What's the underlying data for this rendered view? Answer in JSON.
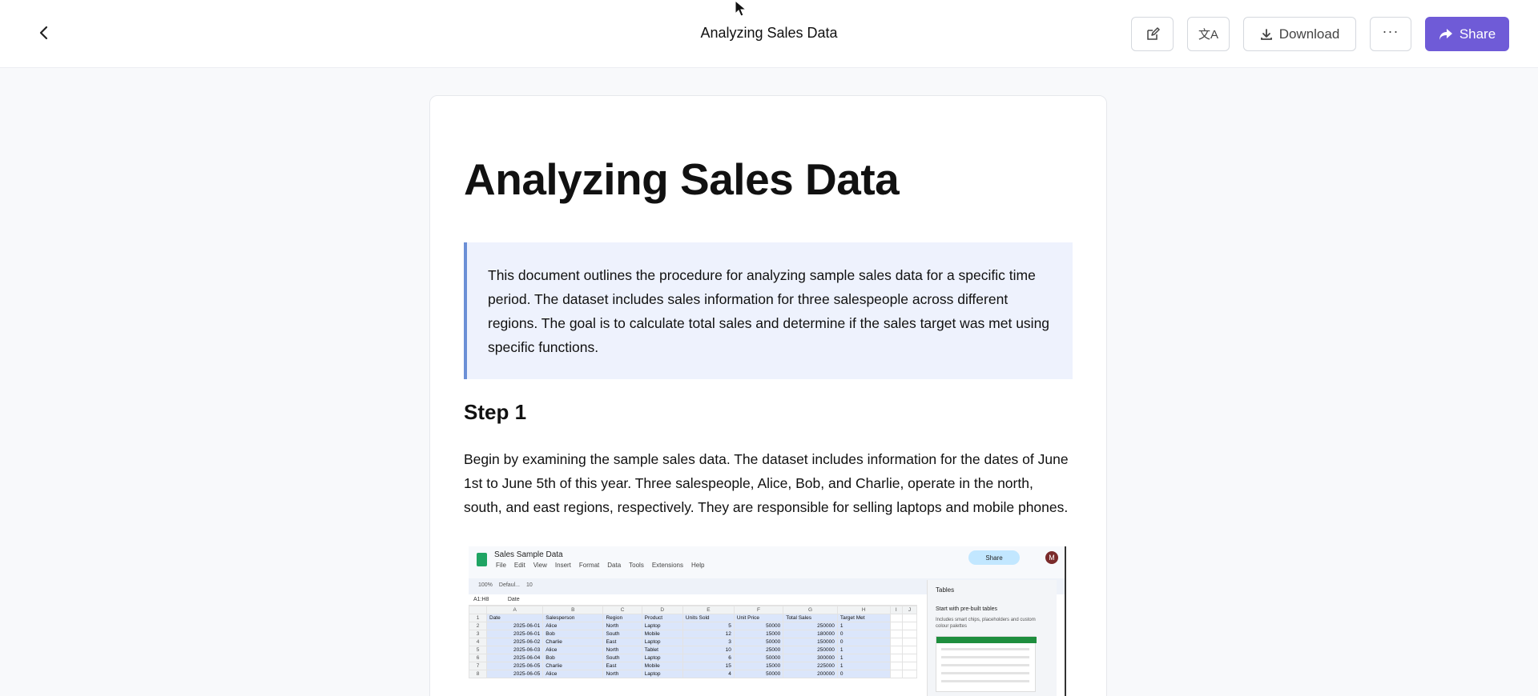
{
  "header": {
    "title": "Analyzing Sales Data",
    "download_label": "Download",
    "share_label": "Share"
  },
  "document": {
    "title": "Analyzing Sales Data",
    "intro": "This document outlines the procedure for analyzing sample sales data for a specific time period. The dataset includes sales information for three salespeople across different regions. The goal is to calculate total sales and determine if the sales target was met using specific functions.",
    "steps": [
      {
        "heading": "Step 1",
        "text": "Begin by examining the sample sales data. The dataset includes information for the dates of June 1st to June 5th of this year. Three salespeople, Alice, Bob, and Charlie, operate in the north, south, and east regions, respectively. They are responsible for selling laptops and mobile phones."
      }
    ]
  },
  "screenshot": {
    "file_name": "Sales Sample Data",
    "menu": [
      "File",
      "Edit",
      "View",
      "Insert",
      "Format",
      "Data",
      "Tools",
      "Extensions",
      "Help"
    ],
    "share_label": "Share",
    "avatar_letter": "M",
    "toolbar_zoom": "100%",
    "toolbar_font": "Defaul...",
    "toolbar_size": "10",
    "cell_ref": "A1:H8",
    "formula_value": "Date",
    "col_letters": [
      "A",
      "B",
      "C",
      "D",
      "E",
      "F",
      "G",
      "H",
      "I",
      "J"
    ],
    "headers": [
      "Date",
      "Salesperson",
      "Region",
      "Product",
      "Units Sold",
      "Unit Price",
      "Total Sales",
      "Target Met"
    ],
    "rows": [
      [
        "2025-06-01",
        "Alice",
        "North",
        "Laptop",
        "5",
        "50000",
        "250000",
        "1"
      ],
      [
        "2025-06-01",
        "Bob",
        "South",
        "Mobile",
        "12",
        "15000",
        "180000",
        "0"
      ],
      [
        "2025-06-02",
        "Charlie",
        "East",
        "Laptop",
        "3",
        "50000",
        "150000",
        "0"
      ],
      [
        "2025-06-03",
        "Alice",
        "North",
        "Tablet",
        "10",
        "25000",
        "250000",
        "1"
      ],
      [
        "2025-06-04",
        "Bob",
        "South",
        "Laptop",
        "6",
        "50000",
        "300000",
        "1"
      ],
      [
        "2025-06-05",
        "Charlie",
        "East",
        "Mobile",
        "15",
        "15000",
        "225000",
        "1"
      ],
      [
        "2025-06-05",
        "Alice",
        "North",
        "Laptop",
        "4",
        "50000",
        "200000",
        "0"
      ]
    ],
    "side_panel_title": "Tables",
    "side_panel_subtitle": "Start with pre-built tables",
    "side_panel_desc": "Includes smart chips, placeholders and custom colour palettes"
  }
}
